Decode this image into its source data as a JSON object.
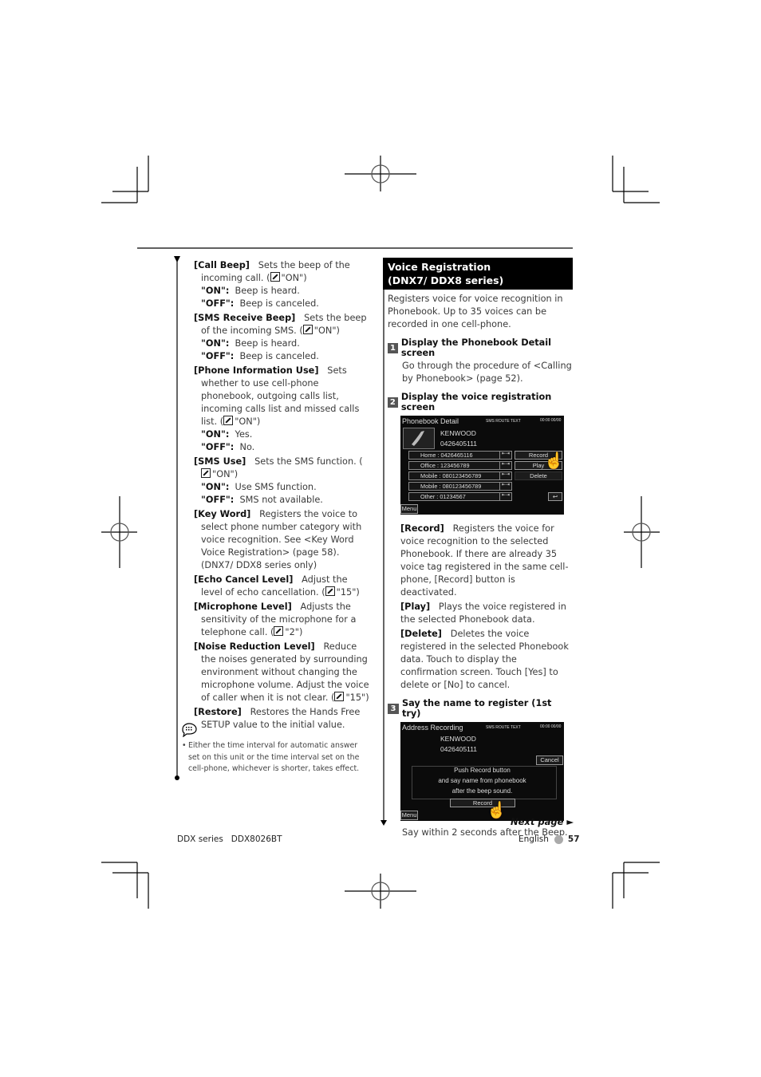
{
  "left_column": {
    "entries": [
      {
        "term": "[Call Beep]",
        "desc": "Sets the beep of the incoming call. (",
        "default": "\"ON\")",
        "options": [
          {
            "k": "\"ON\":",
            "v": "Beep is heard."
          },
          {
            "k": "\"OFF\":",
            "v": "Beep is canceled."
          }
        ]
      },
      {
        "term": "[SMS Receive Beep]",
        "desc": "Sets the beep of the incoming SMS. (",
        "default": "\"ON\")",
        "options": [
          {
            "k": "\"ON\":",
            "v": "Beep is heard."
          },
          {
            "k": "\"OFF\":",
            "v": "Beep is canceled."
          }
        ]
      },
      {
        "term": "[Phone Information Use]",
        "desc": "Sets whether to use cell-phone phonebook, outgoing calls list, incoming calls list and missed calls list. (",
        "default": "\"ON\")",
        "options": [
          {
            "k": "\"ON\":",
            "v": "Yes."
          },
          {
            "k": "\"OFF\":",
            "v": "No."
          }
        ]
      },
      {
        "term": "[SMS Use]",
        "desc": "Sets the SMS function. (",
        "default": "\"ON\")",
        "options": [
          {
            "k": "\"ON\":",
            "v": "Use SMS function."
          },
          {
            "k": "\"OFF\":",
            "v": "SMS not available."
          }
        ]
      },
      {
        "term": "[Key Word]",
        "desc": "Registers the voice to select phone number category with voice recognition. See <Key Word Voice Registration> (page 58). (DNX7/ DDX8 series only)",
        "default": null,
        "options": []
      },
      {
        "term": "[Echo Cancel Level]",
        "desc": "Adjust the level of echo cancellation. (",
        "default": "\"15\")",
        "options": []
      },
      {
        "term": "[Microphone Level]",
        "desc": "Adjusts the sensitivity of the microphone for a telephone call. (",
        "default": "\"2\")",
        "options": []
      },
      {
        "term": "[Noise Reduction Level]",
        "desc": "Reduce the noises generated by surrounding environment without changing the microphone volume. Adjust the voice of caller when it is not clear. (",
        "default": "\"15\")",
        "options": []
      },
      {
        "term": "[Restore]",
        "desc": "Restores the Hands Free SETUP value to the initial value.",
        "default": null,
        "options": []
      }
    ],
    "note_bullet": "•",
    "note_text": "Either the time interval for automatic answer set on this unit or the time interval set on the cell-phone, whichever is shorter, takes effect."
  },
  "right_column": {
    "section_title_1": "Voice Registration",
    "section_title_2": "(DNX7/ DDX8 series)",
    "intro": "Registers voice for voice recognition in Phonebook. Up to 35 voices can be recorded in one cell-phone.",
    "steps": [
      {
        "num": "1",
        "title": "Display the Phonebook Detail screen",
        "body": "Go through the procedure of <Calling by Phonebook> (page 52)."
      },
      {
        "num": "2",
        "title": "Display the voice registration screen"
      },
      {
        "num": "3",
        "title": "Say the name to register (1st try)",
        "caption": "Say within 2 seconds after the Beep."
      }
    ],
    "screen1": {
      "title": "Phonebook Detail",
      "name": "KENWOOD",
      "number": "0426405111",
      "status": "SMS ROUTE TEXT",
      "time": "00:00 00/00",
      "rows": [
        "Home : 0426465116",
        "Office : 123456789",
        "Mobile : 080123456789",
        "Mobile : 080123456789",
        "Other : 01234567"
      ],
      "buttons": {
        "record": "Record",
        "play": "Play",
        "delete": "Delete",
        "menu": "Menu"
      }
    },
    "definitions": [
      {
        "term": "[Record]",
        "desc": "Registers the voice for voice recognition to the selected Phonebook. If there are already 35 voice tag registered in the same cell-phone, [Record] button is deactivated."
      },
      {
        "term": "[Play]",
        "desc": "Plays the voice registered in the selected Phonebook data."
      },
      {
        "term": "[Delete]",
        "desc": "Deletes the voice registered in the selected Phonebook data. Touch to display the confirmation screen. Touch [Yes] to delete or [No] to cancel."
      }
    ],
    "screen2": {
      "title": "Address Recording",
      "name": "KENWOOD",
      "number": "0426405111",
      "message_1": "Push Record button",
      "message_2": "and say name from phonebook",
      "message_3": "after the beep sound.",
      "buttons": {
        "cancel": "Cancel",
        "record": "Record",
        "menu": "Menu"
      }
    }
  },
  "footer": {
    "next_page": "Next page ►",
    "series": "DDX series   DDX8026BT",
    "language": "English",
    "page_number": "57"
  }
}
